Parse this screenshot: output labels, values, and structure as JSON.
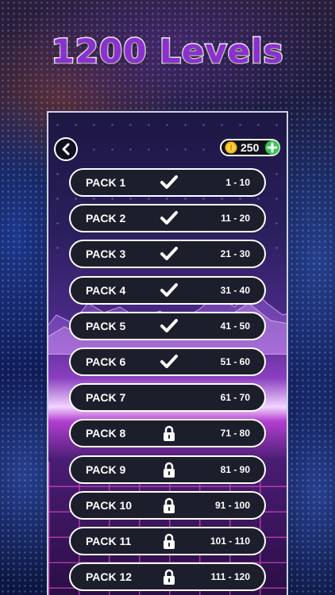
{
  "title": "1200 Levels",
  "header": {
    "back_icon": "chevron-left-icon",
    "coins": {
      "icon": "coin-icon",
      "value": "250",
      "add_icon": "plus-icon"
    }
  },
  "colors": {
    "title_fill": "#8c2fd0",
    "title_stroke": "#ffffff",
    "pack_bg": "#1c1f2b",
    "pack_border": "#ffffff",
    "coin": "#f5b81c",
    "add": "#3ec45a"
  },
  "packs": [
    {
      "name": "PACK 1",
      "range": "1 - 10",
      "status": "completed",
      "status_icon": "checkmark-icon"
    },
    {
      "name": "PACK 2",
      "range": "11 - 20",
      "status": "completed",
      "status_icon": "checkmark-icon"
    },
    {
      "name": "PACK 3",
      "range": "21 - 30",
      "status": "completed",
      "status_icon": "checkmark-icon"
    },
    {
      "name": "PACK 4",
      "range": "31 - 40",
      "status": "completed",
      "status_icon": "checkmark-icon"
    },
    {
      "name": "PACK 5",
      "range": "41 - 50",
      "status": "completed",
      "status_icon": "checkmark-icon"
    },
    {
      "name": "PACK 6",
      "range": "51 - 60",
      "status": "completed",
      "status_icon": "checkmark-icon"
    },
    {
      "name": "PACK 7",
      "range": "61 - 70",
      "status": "open",
      "status_icon": ""
    },
    {
      "name": "PACK 8",
      "range": "71 - 80",
      "status": "locked",
      "status_icon": "lock-icon"
    },
    {
      "name": "PACK 9",
      "range": "81 - 90",
      "status": "locked",
      "status_icon": "lock-icon"
    },
    {
      "name": "PACK 10",
      "range": "91 - 100",
      "status": "locked",
      "status_icon": "lock-icon"
    },
    {
      "name": "PACK 11",
      "range": "101 - 110",
      "status": "locked",
      "status_icon": "lock-icon"
    },
    {
      "name": "PACK 12",
      "range": "111 - 120",
      "status": "locked",
      "status_icon": "lock-icon"
    }
  ]
}
